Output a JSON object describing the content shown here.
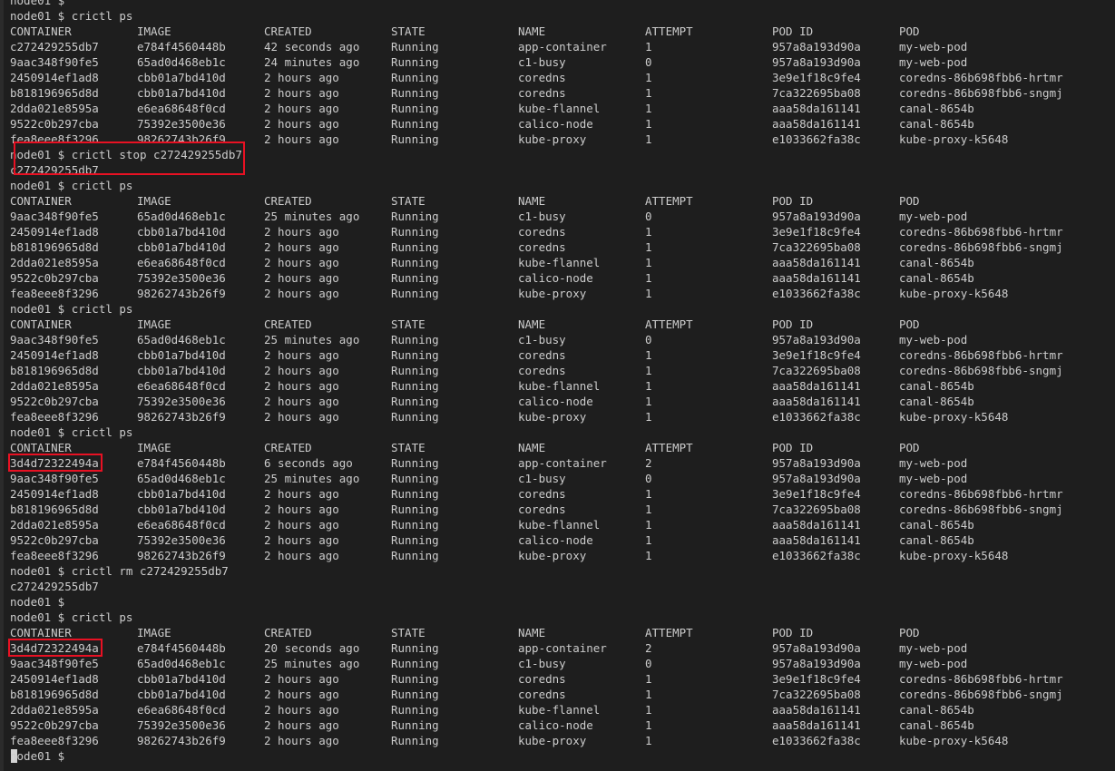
{
  "colors": {
    "background": "#1e1e1e",
    "text": "#cccccc",
    "highlight_box": "#e81123"
  },
  "lines": [
    {
      "type": "text",
      "text": "node01 $"
    },
    {
      "type": "text",
      "text": "node01 $ crictl ps"
    },
    {
      "type": "row",
      "cells": [
        "CONTAINER",
        "IMAGE",
        "CREATED",
        "STATE",
        "NAME",
        "ATTEMPT",
        "POD ID",
        "POD"
      ]
    },
    {
      "type": "row",
      "cells": [
        "c272429255db7",
        "e784f4560448b",
        "42 seconds ago",
        "Running",
        "app-container",
        "1",
        "957a8a193d90a",
        "my-web-pod"
      ]
    },
    {
      "type": "row",
      "cells": [
        "9aac348f90fe5",
        "65ad0d468eb1c",
        "24 minutes ago",
        "Running",
        "c1-busy",
        "0",
        "957a8a193d90a",
        "my-web-pod"
      ]
    },
    {
      "type": "row",
      "cells": [
        "2450914ef1ad8",
        "cbb01a7bd410d",
        "2 hours ago",
        "Running",
        "coredns",
        "1",
        "3e9e1f18c9fe4",
        "coredns-86b698fbb6-hrtmr"
      ]
    },
    {
      "type": "row",
      "cells": [
        "b818196965d8d",
        "cbb01a7bd410d",
        "2 hours ago",
        "Running",
        "coredns",
        "1",
        "7ca322695ba08",
        "coredns-86b698fbb6-sngmj"
      ]
    },
    {
      "type": "row",
      "cells": [
        "2dda021e8595a",
        "e6ea68648f0cd",
        "2 hours ago",
        "Running",
        "kube-flannel",
        "1",
        "aaa58da161141",
        "canal-8654b"
      ]
    },
    {
      "type": "row",
      "cells": [
        "9522c0b297cba",
        "75392e3500e36",
        "2 hours ago",
        "Running",
        "calico-node",
        "1",
        "aaa58da161141",
        "canal-8654b"
      ]
    },
    {
      "type": "row",
      "cells": [
        "fea8eee8f3296",
        "98262743b26f9",
        "2 hours ago",
        "Running",
        "kube-proxy",
        "1",
        "e1033662fa38c",
        "kube-proxy-k5648"
      ]
    },
    {
      "type": "text",
      "text": "node01 $ crictl stop c272429255db7"
    },
    {
      "type": "text",
      "text": "c272429255db7"
    },
    {
      "type": "text",
      "text": "node01 $ crictl ps"
    },
    {
      "type": "row",
      "cells": [
        "CONTAINER",
        "IMAGE",
        "CREATED",
        "STATE",
        "NAME",
        "ATTEMPT",
        "POD ID",
        "POD"
      ]
    },
    {
      "type": "row",
      "cells": [
        "9aac348f90fe5",
        "65ad0d468eb1c",
        "25 minutes ago",
        "Running",
        "c1-busy",
        "0",
        "957a8a193d90a",
        "my-web-pod"
      ]
    },
    {
      "type": "row",
      "cells": [
        "2450914ef1ad8",
        "cbb01a7bd410d",
        "2 hours ago",
        "Running",
        "coredns",
        "1",
        "3e9e1f18c9fe4",
        "coredns-86b698fbb6-hrtmr"
      ]
    },
    {
      "type": "row",
      "cells": [
        "b818196965d8d",
        "cbb01a7bd410d",
        "2 hours ago",
        "Running",
        "coredns",
        "1",
        "7ca322695ba08",
        "coredns-86b698fbb6-sngmj"
      ]
    },
    {
      "type": "row",
      "cells": [
        "2dda021e8595a",
        "e6ea68648f0cd",
        "2 hours ago",
        "Running",
        "kube-flannel",
        "1",
        "aaa58da161141",
        "canal-8654b"
      ]
    },
    {
      "type": "row",
      "cells": [
        "9522c0b297cba",
        "75392e3500e36",
        "2 hours ago",
        "Running",
        "calico-node",
        "1",
        "aaa58da161141",
        "canal-8654b"
      ]
    },
    {
      "type": "row",
      "cells": [
        "fea8eee8f3296",
        "98262743b26f9",
        "2 hours ago",
        "Running",
        "kube-proxy",
        "1",
        "e1033662fa38c",
        "kube-proxy-k5648"
      ]
    },
    {
      "type": "text",
      "text": "node01 $ crictl ps"
    },
    {
      "type": "row",
      "cells": [
        "CONTAINER",
        "IMAGE",
        "CREATED",
        "STATE",
        "NAME",
        "ATTEMPT",
        "POD ID",
        "POD"
      ]
    },
    {
      "type": "row",
      "cells": [
        "9aac348f90fe5",
        "65ad0d468eb1c",
        "25 minutes ago",
        "Running",
        "c1-busy",
        "0",
        "957a8a193d90a",
        "my-web-pod"
      ]
    },
    {
      "type": "row",
      "cells": [
        "2450914ef1ad8",
        "cbb01a7bd410d",
        "2 hours ago",
        "Running",
        "coredns",
        "1",
        "3e9e1f18c9fe4",
        "coredns-86b698fbb6-hrtmr"
      ]
    },
    {
      "type": "row",
      "cells": [
        "b818196965d8d",
        "cbb01a7bd410d",
        "2 hours ago",
        "Running",
        "coredns",
        "1",
        "7ca322695ba08",
        "coredns-86b698fbb6-sngmj"
      ]
    },
    {
      "type": "row",
      "cells": [
        "2dda021e8595a",
        "e6ea68648f0cd",
        "2 hours ago",
        "Running",
        "kube-flannel",
        "1",
        "aaa58da161141",
        "canal-8654b"
      ]
    },
    {
      "type": "row",
      "cells": [
        "9522c0b297cba",
        "75392e3500e36",
        "2 hours ago",
        "Running",
        "calico-node",
        "1",
        "aaa58da161141",
        "canal-8654b"
      ]
    },
    {
      "type": "row",
      "cells": [
        "fea8eee8f3296",
        "98262743b26f9",
        "2 hours ago",
        "Running",
        "kube-proxy",
        "1",
        "e1033662fa38c",
        "kube-proxy-k5648"
      ]
    },
    {
      "type": "text",
      "text": "node01 $ crictl ps"
    },
    {
      "type": "row",
      "cells": [
        "CONTAINER",
        "IMAGE",
        "CREATED",
        "STATE",
        "NAME",
        "ATTEMPT",
        "POD ID",
        "POD"
      ]
    },
    {
      "type": "row",
      "cells": [
        "3d4d72322494a",
        "e784f4560448b",
        "6 seconds ago",
        "Running",
        "app-container",
        "2",
        "957a8a193d90a",
        "my-web-pod"
      ]
    },
    {
      "type": "row",
      "cells": [
        "9aac348f90fe5",
        "65ad0d468eb1c",
        "25 minutes ago",
        "Running",
        "c1-busy",
        "0",
        "957a8a193d90a",
        "my-web-pod"
      ]
    },
    {
      "type": "row",
      "cells": [
        "2450914ef1ad8",
        "cbb01a7bd410d",
        "2 hours ago",
        "Running",
        "coredns",
        "1",
        "3e9e1f18c9fe4",
        "coredns-86b698fbb6-hrtmr"
      ]
    },
    {
      "type": "row",
      "cells": [
        "b818196965d8d",
        "cbb01a7bd410d",
        "2 hours ago",
        "Running",
        "coredns",
        "1",
        "7ca322695ba08",
        "coredns-86b698fbb6-sngmj"
      ]
    },
    {
      "type": "row",
      "cells": [
        "2dda021e8595a",
        "e6ea68648f0cd",
        "2 hours ago",
        "Running",
        "kube-flannel",
        "1",
        "aaa58da161141",
        "canal-8654b"
      ]
    },
    {
      "type": "row",
      "cells": [
        "9522c0b297cba",
        "75392e3500e36",
        "2 hours ago",
        "Running",
        "calico-node",
        "1",
        "aaa58da161141",
        "canal-8654b"
      ]
    },
    {
      "type": "row",
      "cells": [
        "fea8eee8f3296",
        "98262743b26f9",
        "2 hours ago",
        "Running",
        "kube-proxy",
        "1",
        "e1033662fa38c",
        "kube-proxy-k5648"
      ]
    },
    {
      "type": "text",
      "text": "node01 $ crictl rm c272429255db7"
    },
    {
      "type": "text",
      "text": "c272429255db7"
    },
    {
      "type": "text",
      "text": "node01 $"
    },
    {
      "type": "text",
      "text": "node01 $ crictl ps"
    },
    {
      "type": "row",
      "cells": [
        "CONTAINER",
        "IMAGE",
        "CREATED",
        "STATE",
        "NAME",
        "ATTEMPT",
        "POD ID",
        "POD"
      ]
    },
    {
      "type": "row",
      "cells": [
        "3d4d72322494a",
        "e784f4560448b",
        "20 seconds ago",
        "Running",
        "app-container",
        "2",
        "957a8a193d90a",
        "my-web-pod"
      ]
    },
    {
      "type": "row",
      "cells": [
        "9aac348f90fe5",
        "65ad0d468eb1c",
        "25 minutes ago",
        "Running",
        "c1-busy",
        "0",
        "957a8a193d90a",
        "my-web-pod"
      ]
    },
    {
      "type": "row",
      "cells": [
        "2450914ef1ad8",
        "cbb01a7bd410d",
        "2 hours ago",
        "Running",
        "coredns",
        "1",
        "3e9e1f18c9fe4",
        "coredns-86b698fbb6-hrtmr"
      ]
    },
    {
      "type": "row",
      "cells": [
        "b818196965d8d",
        "cbb01a7bd410d",
        "2 hours ago",
        "Running",
        "coredns",
        "1",
        "7ca322695ba08",
        "coredns-86b698fbb6-sngmj"
      ]
    },
    {
      "type": "row",
      "cells": [
        "2dda021e8595a",
        "e6ea68648f0cd",
        "2 hours ago",
        "Running",
        "kube-flannel",
        "1",
        "aaa58da161141",
        "canal-8654b"
      ]
    },
    {
      "type": "row",
      "cells": [
        "9522c0b297cba",
        "75392e3500e36",
        "2 hours ago",
        "Running",
        "calico-node",
        "1",
        "aaa58da161141",
        "canal-8654b"
      ]
    },
    {
      "type": "row",
      "cells": [
        "fea8eee8f3296",
        "98262743b26f9",
        "2 hours ago",
        "Running",
        "kube-proxy",
        "1",
        "e1033662fa38c",
        "kube-proxy-k5648"
      ]
    },
    {
      "type": "prompt",
      "text": "node01 $ "
    }
  ]
}
